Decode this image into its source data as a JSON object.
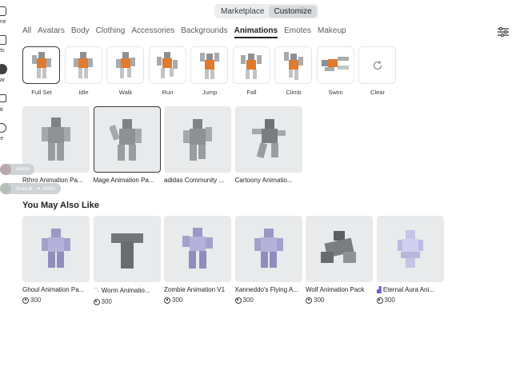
{
  "rail": {
    "items": [
      {
        "label": "ome",
        "icon": "home-icon"
      },
      {
        "label": "arts",
        "icon": "charts-icon"
      },
      {
        "label": "atar",
        "icon": "avatar-icon"
      },
      {
        "label": "hat",
        "icon": "chat-icon"
      },
      {
        "label": "ore",
        "icon": "more-icon"
      }
    ]
  },
  "switch": {
    "marketplace": "Marketplace",
    "customize": "Customize"
  },
  "tabs": [
    "All",
    "Avatars",
    "Body",
    "Clothing",
    "Accessories",
    "Backgrounds",
    "Animations",
    "Emotes",
    "Makeup"
  ],
  "active_tab": "Animations",
  "presets": [
    "Full Set",
    "Idle",
    "Walk",
    "Run",
    "Jump",
    "Fall",
    "Climb",
    "Swim",
    "Clear"
  ],
  "owned": [
    {
      "name": "Rthro Animation Pa..."
    },
    {
      "name": "Mage Animation Pa..."
    },
    {
      "name": "adidas Community ..."
    },
    {
      "name": "Cartoony Animatio..."
    }
  ],
  "section_title": "You May Also Like",
  "recommended": [
    {
      "name": "Ghoul Animation Pa...",
      "price": "300"
    },
    {
      "name": "Worm Animatio...",
      "price": "300"
    },
    {
      "name": "Zombie Animation V1",
      "price": "300"
    },
    {
      "name": "Xanneddo's Flying A...",
      "price": "300"
    },
    {
      "name": "Wolf Animation Pack",
      "price": "300"
    },
    {
      "name": "Eternal Aura Ani...",
      "price": "300"
    }
  ],
  "chat_pills": [
    "Ashmi",
    "Ƨtoiq ✿ · ✦ #RMG"
  ],
  "colors": {
    "accent": "#1e1f21",
    "shirt": "#e07a2e",
    "tile": "#e9eaeb"
  }
}
